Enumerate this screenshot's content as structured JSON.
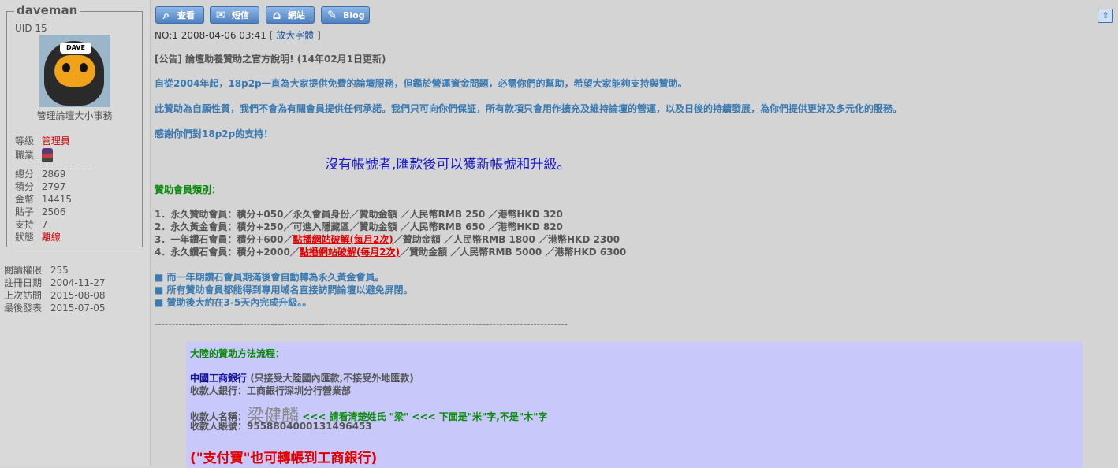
{
  "profile": {
    "username": "daveman",
    "uid": "UID 15",
    "avatar_caption": "DAVE",
    "title": "管理論壇大小事務",
    "stats": [
      {
        "key": "等級",
        "value": "管理員",
        "red": true
      },
      {
        "key": "職業",
        "value": ""
      },
      {
        "key": "總分",
        "value": "2869"
      },
      {
        "key": "積分",
        "value": "2797"
      },
      {
        "key": "金幣",
        "value": "14415"
      },
      {
        "key": "貼子",
        "value": "2506"
      },
      {
        "key": "支持",
        "value": "7"
      },
      {
        "key": "狀態",
        "value": "離線",
        "red": true
      }
    ],
    "info": [
      {
        "key": "閱讀權限",
        "value": "255"
      },
      {
        "key": "註冊日期",
        "value": "2004-11-27"
      },
      {
        "key": "上次訪問",
        "value": "2015-08-08"
      },
      {
        "key": "最後發表",
        "value": "2015-07-05"
      }
    ]
  },
  "toolbar": {
    "buttons": [
      {
        "label": "查看",
        "icon": "search-icon"
      },
      {
        "label": "短信",
        "icon": "message-icon"
      },
      {
        "label": "網站",
        "icon": "home-icon"
      },
      {
        "label": "Blog",
        "icon": "pencil-icon"
      }
    ],
    "top_icon": "arrow-up-icon"
  },
  "post": {
    "number": "NO:1",
    "datetime": "2008-04-06 03:41",
    "enlarge_label": "放大字體",
    "heading": "[公告] 論壇助養贊助之官方說明! (14年02月1日更新)",
    "para1": "自從2004年起，18p2p一直為大家提供免費的論壇服務，但鑑於營運資金問題，必需你們的幫助，希望大家能夠支持與贊助。",
    "para2": "此贊助為自願性質，我們不會為有關會員提供任何承諾。我們只可向你們保証，所有款項只會用作擴充及維持論壇的營運，以及日後的持續發展，為你們提供更好及多元化的服務。",
    "para3": "感謝你們對18p2p的支持！",
    "notice": "沒有帳號者,匯款後可以獲新帳號和升級。",
    "category_title": "贊助會員類別：",
    "tiers": [
      {
        "pre": "1．永久贊助會員：積分+050／永久會員身份／贊助金額 ／人民幣RMB 250 ／港幣HKD 320",
        "link": "",
        "post": ""
      },
      {
        "pre": "2．永久黃金會員：積分+250／可進入隱藏區／贊助金額 ／人民幣RMB 650 ／港幣HKD 820",
        "link": "",
        "post": ""
      },
      {
        "pre": "3．一年鑽石會員：積分+600／",
        "link": "點播網站破解(每月2次)",
        "post": "／贊助金額 ／人民幣RMB 1800 ／港幣HKD 2300"
      },
      {
        "pre": "4．永久鑽石會員：積分+2000／",
        "link": "點播網站破解(每月2次)",
        "post": "／贊助金額 ／人民幣RMB 5000 ／港幣HKD 6300"
      }
    ],
    "notes": [
      "■ 而一年期鑽石會員期滿後會自動轉為永久黃金會員。",
      "■ 所有贊助會員都能得到專用域名直接訪問論壇以避免屏閉。",
      "■ 贊助後大約在3-5天內完成升級。。"
    ],
    "divider": "-------------------------------------------------------------------------------------------------------------------------"
  },
  "bank": {
    "title": "大陸的贊助方法流程：",
    "bank_name": "中國工商銀行",
    "bank_note": " (只接受大陸國內匯款,不接受外地匯款)",
    "receiving_bank": "收款人銀行：工商銀行深圳分行營業部",
    "payee_label": "收款人名稱：",
    "payee_name": "梁健麟",
    "payee_note": " <<< 請看清楚姓氏 \"梁\" <<< 下面是\"米\"字,不是\"木\"字",
    "account": "收款人賬號：9558804000131496453",
    "alipay": "(\"支付寶\"也可轉帳到工商銀行)"
  }
}
